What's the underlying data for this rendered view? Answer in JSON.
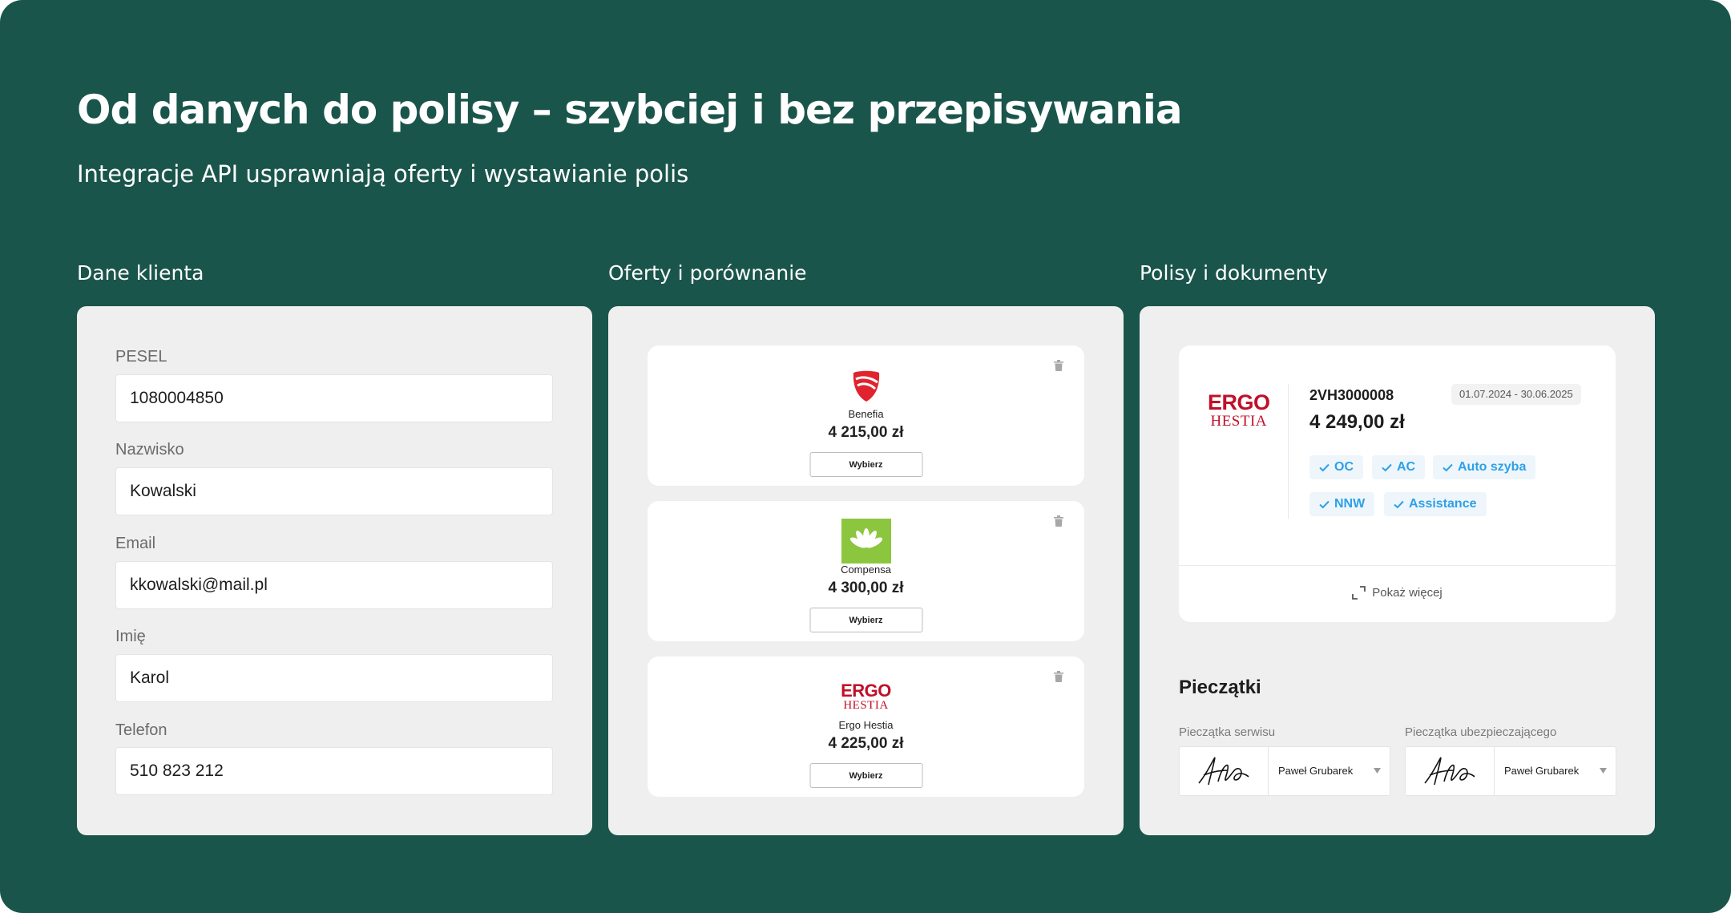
{
  "header": {
    "title": "Od danych do polisy – szybciej i bez przepisywania",
    "subtitle": "Integracje API usprawniają oferty i wystawianie polis"
  },
  "sections": {
    "client": "Dane klienta",
    "offers": "Oferty i porównanie",
    "policies": "Polisy i dokumenty"
  },
  "client_form": {
    "fields": [
      {
        "label": "PESEL",
        "value": "1080004850"
      },
      {
        "label": "Nazwisko",
        "value": "Kowalski"
      },
      {
        "label": "Email",
        "value": "kkowalski@mail.pl"
      },
      {
        "label": "Imię",
        "value": "Karol"
      },
      {
        "label": "Telefon",
        "value": "510 823 212"
      }
    ]
  },
  "offers": [
    {
      "insurer": "Benefia",
      "price": "4 215,00 zł",
      "select_label": "Wybierz",
      "logo_icon": "benefia-shield-icon"
    },
    {
      "insurer": "Compensa",
      "price": "4 300,00 zł",
      "select_label": "Wybierz",
      "logo_icon": "compensa-logo-icon"
    },
    {
      "insurer": "Ergo Hestia",
      "price": "4 225,00 zł",
      "select_label": "Wybierz",
      "logo_icon": "ergo-hestia-logo"
    }
  ],
  "ergo_logo": {
    "line1": "ERGO",
    "line2": "HESTIA"
  },
  "policy": {
    "number": "2VH3000008",
    "dates": "01.07.2024 - 30.06.2025",
    "price": "4 249,00 zł",
    "coverages": [
      "OC",
      "AC",
      "Auto szyba",
      "NNW",
      "Assistance"
    ],
    "show_more": "Pokaż więcej"
  },
  "stamps": {
    "title": "Pieczątki",
    "service": {
      "label": "Pieczątka serwisu",
      "selected": "Paweł Grubarek"
    },
    "insurer": {
      "label": "Pieczątka ubezpieczającego",
      "selected": "Paweł Grubarek"
    }
  },
  "colors": {
    "background": "#1a554b",
    "panel": "#efefef",
    "ergo_red": "#c0102a",
    "benefia_red": "#e0232e",
    "compensa_green": "#8cc63e",
    "coverage_blue": "#2ea0e8"
  }
}
